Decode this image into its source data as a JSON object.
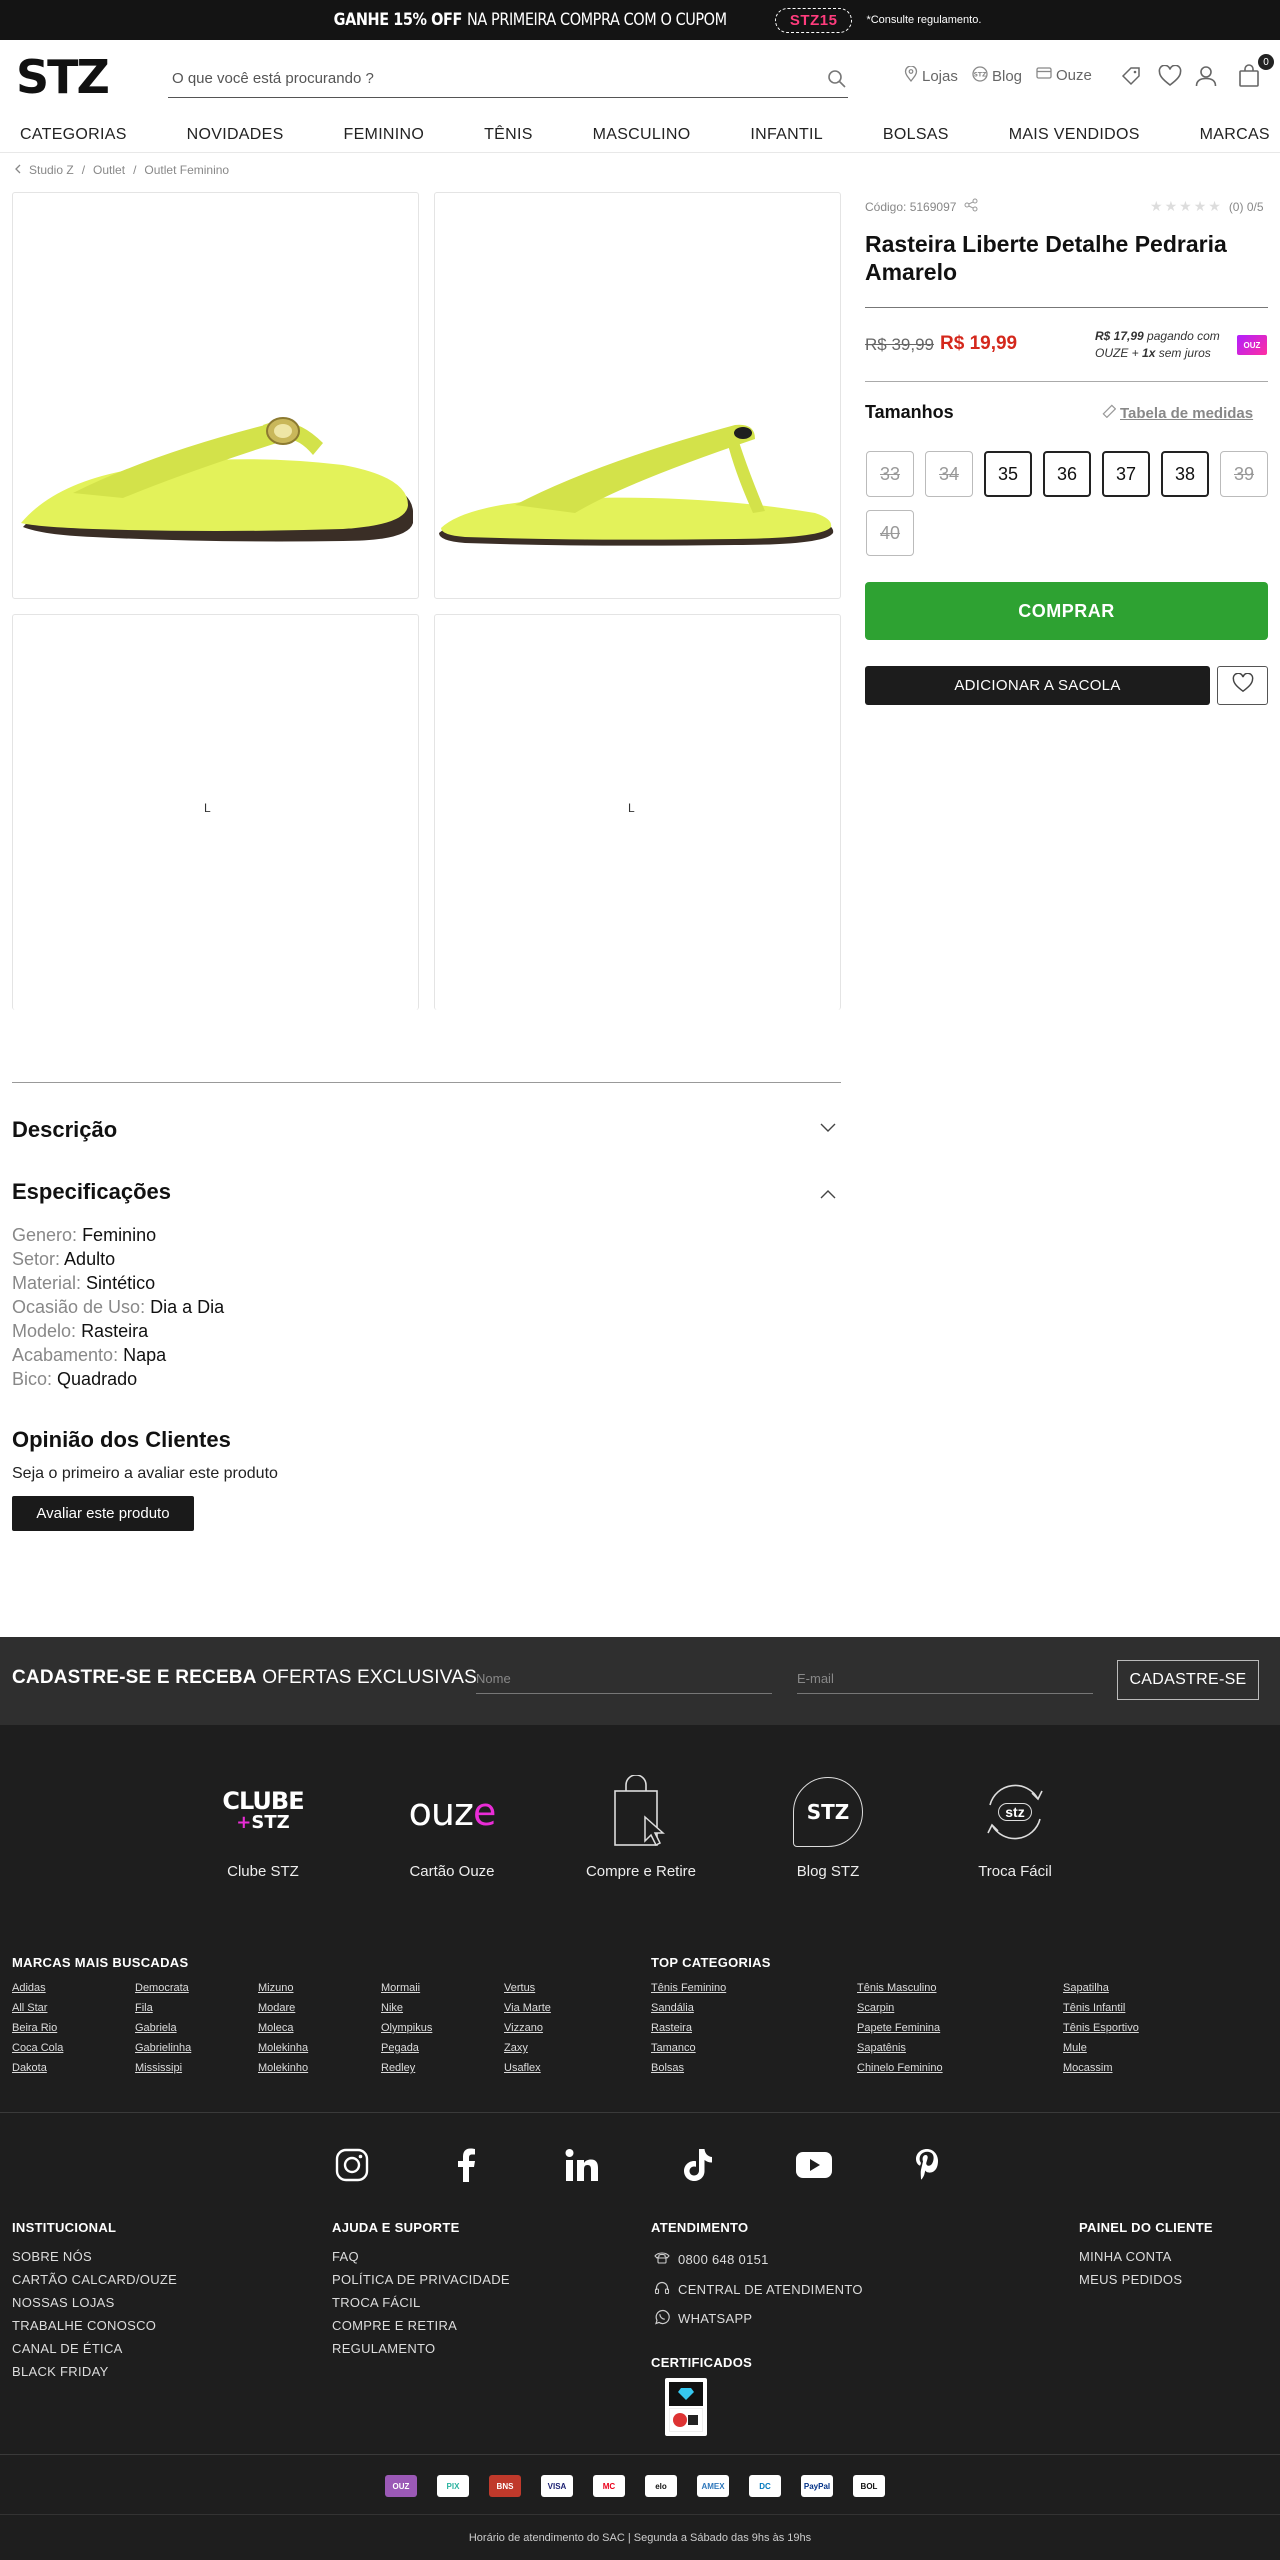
{
  "promo": {
    "headline_bold": "GANHE 15% OFF",
    "headline_rest": "NA PRIMEIRA COMPRA COM O CUPOM",
    "coupon": "STZ15",
    "note": "*Consulte regulamento."
  },
  "header": {
    "logo": "STZ",
    "search_placeholder": "O que você está procurando ?",
    "links": [
      "Lojas",
      "Blog",
      "Ouze"
    ],
    "cart_count": "0"
  },
  "nav": [
    "CATEGORIAS",
    "NOVIDADES",
    "FEMININO",
    "TÊNIS",
    "MASCULINO",
    "INFANTIL",
    "BOLSAS",
    "MAIS VENDIDOS",
    "MARCAS"
  ],
  "breadcrumb": [
    "Studio Z",
    "Outlet",
    "Outlet Feminino"
  ],
  "product": {
    "code": "Código: 5169097",
    "rating": "(0) 0/5",
    "title": "Rasteira Liberte Detalhe Pedraria Amarelo",
    "old_price": "R$ 39,99",
    "price": "R$ 19,99",
    "ouze_price": "R$ 17,99",
    "ouze_text1": "pagando com",
    "ouze_text2": "OUZE +",
    "ouze_text3": "1x",
    "ouze_text4": "sem juros",
    "ouze_badge": "OUZ",
    "sizes_title": "Tamanhos",
    "size_chart": "Tabela de medidas",
    "sizes": [
      {
        "label": "33",
        "available": false
      },
      {
        "label": "34",
        "available": false
      },
      {
        "label": "35",
        "available": true
      },
      {
        "label": "36",
        "available": true
      },
      {
        "label": "37",
        "available": true
      },
      {
        "label": "38",
        "available": true
      },
      {
        "label": "39",
        "available": false
      },
      {
        "label": "40",
        "available": false
      }
    ],
    "buy": "COMPRAR",
    "add_bag": "ADICIONAR A SACOLA",
    "loader_mark": "L",
    "shoe_color": "#e3f25a"
  },
  "details": {
    "description_title": "Descrição",
    "specs_title": "Especificações",
    "specs": [
      {
        "k": "Genero:",
        "v": "Feminino"
      },
      {
        "k": "Setor:",
        "v": "Adulto"
      },
      {
        "k": "Material:",
        "v": "Sintético"
      },
      {
        "k": "Ocasião de Uso:",
        "v": "Dia a Dia"
      },
      {
        "k": "Modelo:",
        "v": "Rasteira"
      },
      {
        "k": "Acabamento:",
        "v": "Napa"
      },
      {
        "k": "Bico:",
        "v": "Quadrado"
      }
    ],
    "reviews_title": "Opinião dos Clientes",
    "reviews_empty": "Seja o primeiro a avaliar este produto",
    "review_button": "Avaliar este produto"
  },
  "newsletter": {
    "bold": "CADASTRE-SE E RECEBA",
    "rest": "OFERTAS EXCLUSIVAS",
    "name_placeholder": "Nome",
    "email_placeholder": "E-mail",
    "button": "CADASTRE-SE"
  },
  "footer": {
    "features": [
      {
        "label": "Clube STZ",
        "logo_line1": "CLUBE",
        "logo_line2": "+STZ"
      },
      {
        "label": "Cartão Ouze",
        "logo": "ouze"
      },
      {
        "label": "Compre e Retire"
      },
      {
        "label": "Blog STZ",
        "logo": "STZ"
      },
      {
        "label": "Troca Fácil",
        "logo": "stz"
      }
    ],
    "brands_title": "MARCAS MAIS BUSCADAS",
    "brands": [
      [
        "Adidas",
        "All Star",
        "Beira Rio",
        "Coca Cola",
        "Dakota"
      ],
      [
        "Democrata",
        "Fila",
        "Gabriela",
        "Gabrielinha",
        "Mississipi"
      ],
      [
        "Mizuno",
        "Modare",
        "Moleca",
        "Molekinha",
        "Molekinho"
      ],
      [
        "Mormaii",
        "Nike",
        "Olympikus",
        "Pegada",
        "Redley"
      ],
      [
        "Vertus",
        "Via Marte",
        "Vizzano",
        "Zaxy",
        "Usaflex"
      ]
    ],
    "top_title": "TOP CATEGORIAS",
    "top": [
      [
        "Tênis Feminino",
        "Sandália",
        "Rasteira",
        "Tamanco",
        "Bolsas"
      ],
      [
        "Tênis Masculino",
        "Scarpin",
        "Papete Feminina",
        "Sapatênis",
        "Chinelo Feminino"
      ],
      [
        "Sapatilha",
        "Tênis Infantil",
        "Tênis Esportivo",
        "Mule",
        "Mocassim"
      ]
    ],
    "institucional_title": "INSTITUCIONAL",
    "institucional": [
      "SOBRE NÓS",
      "CARTÃO CALCARD/OUZE",
      "NOSSAS LOJAS",
      "TRABALHE CONOSCO",
      "CANAL DE ÉTICA",
      "BLACK FRIDAY"
    ],
    "ajuda_title": "AJUDA E SUPORTE",
    "ajuda": [
      "FAQ",
      "POLÍTICA DE PRIVACIDADE",
      "TROCA FÁCIL",
      "COMPRE E RETIRA",
      "REGULAMENTO"
    ],
    "atend_title": "ATENDIMENTO",
    "atend": [
      "0800 648 0151",
      "CENTRAL DE ATENDIMENTO",
      "WHATSAPP"
    ],
    "cert_title": "CERTIFICADOS",
    "painel_title": "PAINEL DO CLIENTE",
    "painel": [
      "MINHA CONTA",
      "MEUS PEDIDOS"
    ],
    "payments": [
      "OUZ",
      "PIX",
      "BNS",
      "VISA",
      "MC",
      "elo",
      "AMEX",
      "DC",
      "PayPal",
      "BOL"
    ],
    "sac": "Horário de atendimento do SAC | Segunda a Sábado das 9hs às 19hs"
  }
}
